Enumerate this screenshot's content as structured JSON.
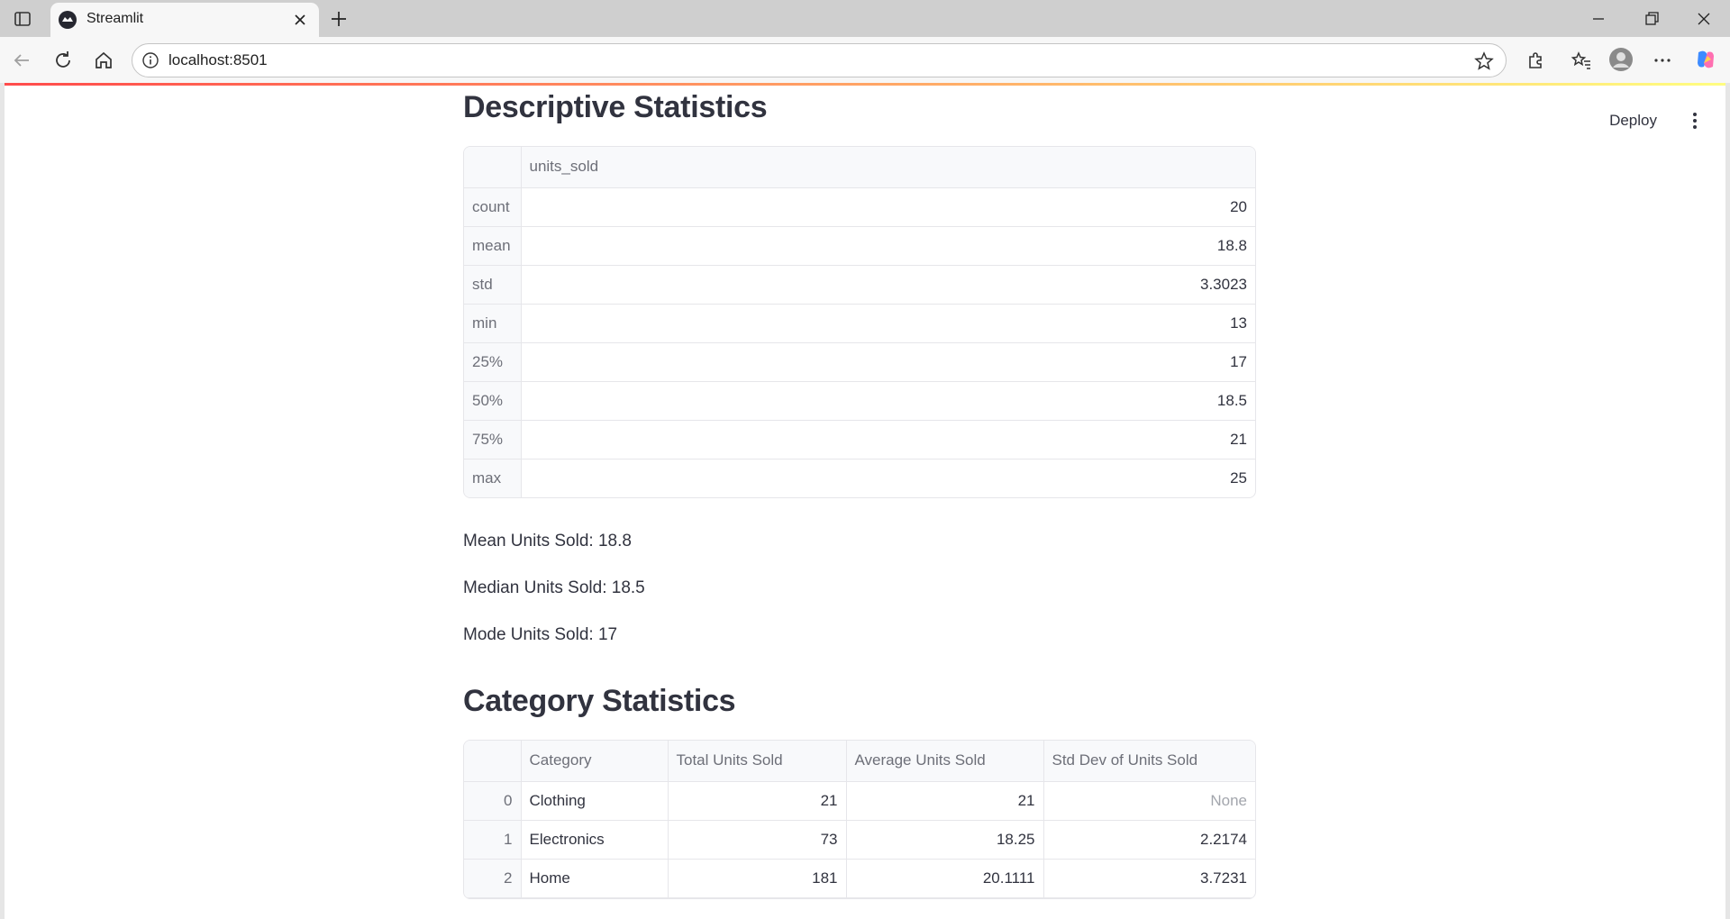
{
  "browser": {
    "tab_title": "Streamlit",
    "url": "localhost:8501"
  },
  "header": {
    "deploy_label": "Deploy"
  },
  "descriptive": {
    "title": "Descriptive Statistics",
    "column": "units_sold",
    "rows": [
      {
        "label": "count",
        "value": "20"
      },
      {
        "label": "mean",
        "value": "18.8"
      },
      {
        "label": "std",
        "value": "3.3023"
      },
      {
        "label": "min",
        "value": "13"
      },
      {
        "label": "25%",
        "value": "17"
      },
      {
        "label": "50%",
        "value": "18.5"
      },
      {
        "label": "75%",
        "value": "21"
      },
      {
        "label": "max",
        "value": "25"
      }
    ]
  },
  "summary": {
    "mean_text": "Mean Units Sold: 18.8",
    "median_text": "Median Units Sold: 18.5",
    "mode_text": "Mode Units Sold: 17"
  },
  "category": {
    "title": "Category Statistics",
    "columns": [
      "Category",
      "Total Units Sold",
      "Average Units Sold",
      "Std Dev of Units Sold"
    ],
    "rows": [
      {
        "index": "0",
        "category": "Clothing",
        "total": "21",
        "average": "21",
        "std": "None"
      },
      {
        "index": "1",
        "category": "Electronics",
        "total": "73",
        "average": "18.25",
        "std": "2.2174"
      },
      {
        "index": "2",
        "category": "Home",
        "total": "181",
        "average": "20.1111",
        "std": "3.7231"
      }
    ]
  }
}
